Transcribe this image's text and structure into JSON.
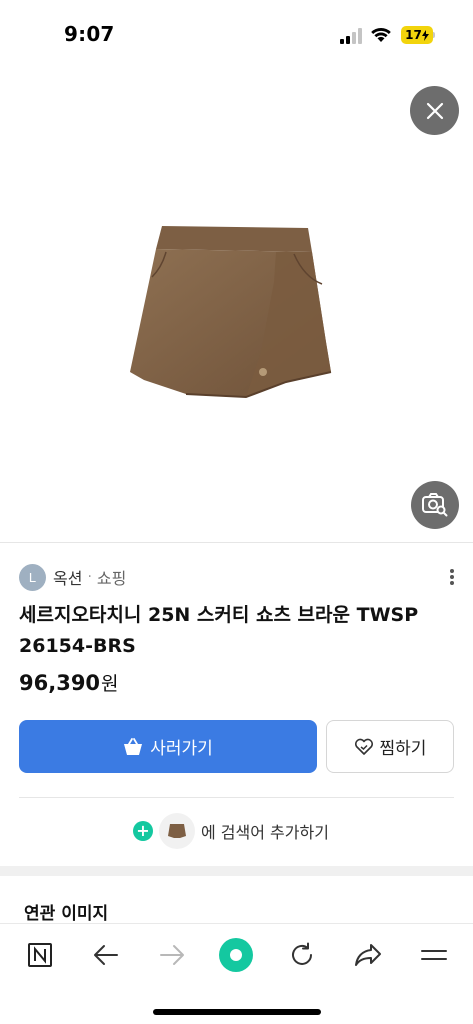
{
  "status_bar": {
    "time": "9:07",
    "battery": "17"
  },
  "source": {
    "avatar_letter": "L",
    "name": "옥션",
    "separator": "·",
    "category": "쇼핑"
  },
  "product": {
    "title": "세르지오타치니 25N 스커티 쇼츠 브라운 TWSP 26154-BRS",
    "price": "96,390",
    "price_unit": "원",
    "image_icon": "brown-skort-image",
    "color": "#8a6b4e"
  },
  "actions": {
    "buy_label": "사러가기",
    "wish_label": "찜하기",
    "add_search_label": "에 검색어 추가하기"
  },
  "related": {
    "title": "연관 이미지"
  },
  "toolbar": {
    "items": [
      "naver-home-icon",
      "back-arrow-icon",
      "forward-arrow-icon",
      "green-dot-icon",
      "refresh-icon",
      "share-icon",
      "menu-icon"
    ]
  },
  "colors": {
    "primary": "#3b7be3",
    "accent_green": "#14c8a0",
    "battery_yellow": "#f2d40c"
  }
}
